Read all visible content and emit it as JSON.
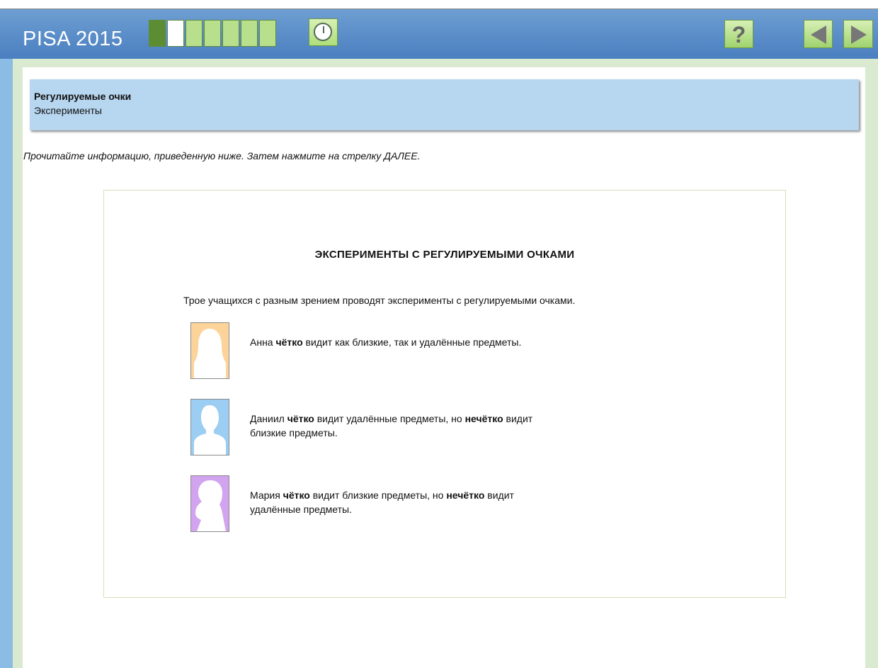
{
  "header": {
    "app_title": "PISA 2015",
    "progress": {
      "total": 7,
      "completed": 1,
      "current": 2
    },
    "timer_icon": "timer-icon",
    "help_glyph": "?"
  },
  "task": {
    "title": "Регулируемые очки",
    "subtitle": "Эксперименты",
    "instruction": "Прочитайте информацию, приведенную ниже. Затем нажмите на стрелку ДАЛЕЕ."
  },
  "stimulus": {
    "heading": "ЭКСПЕРИМЕНТЫ С РЕГУЛИРУЕМЫМИ ОЧКАМИ",
    "intro": "Трое учащихся с разным зрением проводят эксперименты с регулируемыми очками.",
    "people": [
      {
        "name": "Анна",
        "text_parts": [
          "Анна ",
          "чётко",
          " видит как близкие, так и удалённые предметы."
        ],
        "line2": "",
        "avatar_color": "#fcd49a",
        "avatar_icon": "female-silhouette-icon"
      },
      {
        "name": "Даниил",
        "text_parts": [
          "Даниил ",
          "чётко",
          " видит удалённые предметы, но ",
          "нечётко",
          " видит"
        ],
        "line2": "близкие предметы.",
        "avatar_color": "#9ccdf3",
        "avatar_icon": "male-silhouette-icon"
      },
      {
        "name": "Мария",
        "text_parts": [
          "Мария ",
          "чётко",
          " видит близкие предметы, но ",
          "нечётко",
          " видит"
        ],
        "line2": "удалённые предметы.",
        "avatar_color": "#d2a3ee",
        "avatar_icon": "female-silhouette-icon"
      }
    ]
  },
  "colors": {
    "header_blue": "#4a7fc0",
    "title_bar_blue": "#b7d6f0",
    "progress_done": "#5d8d33",
    "progress_todo": "#b8df8c",
    "button_green": "#aede7a"
  }
}
